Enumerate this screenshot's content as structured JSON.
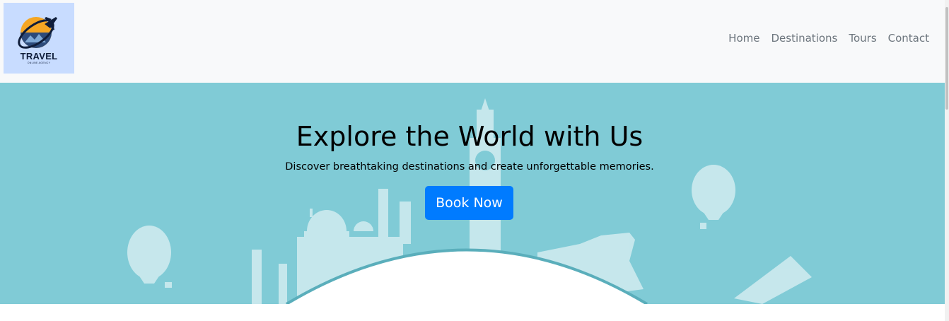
{
  "logo": {
    "title": "TRAVEL",
    "subtitle": "ONLINE AGENCY"
  },
  "nav": {
    "items": [
      {
        "label": "Home"
      },
      {
        "label": "Destinations"
      },
      {
        "label": "Tours"
      },
      {
        "label": "Contact"
      }
    ]
  },
  "hero": {
    "title": "Explore the World with Us",
    "subtitle": "Discover breathtaking destinations and create unforgettable memories.",
    "button_label": "Book Now"
  },
  "colors": {
    "navbar_bg": "#f8f9fa",
    "hero_bg": "#80cbd6",
    "button": "#007bff",
    "nav_text": "#6c757d"
  }
}
